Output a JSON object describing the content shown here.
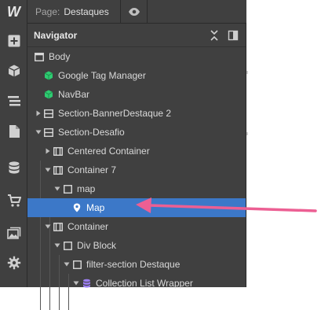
{
  "app": {
    "logo": "W"
  },
  "topbar": {
    "page_label": "Page:",
    "page_name": "Destaques"
  },
  "rail_icons": [
    "add-icon",
    "box-icon",
    "navigator-icon",
    "pages-icon",
    "cms-icon",
    "ecommerce-icon",
    "assets-icon",
    "settings-icon"
  ],
  "navigator": {
    "title": "Navigator",
    "items": [
      {
        "label": "Body",
        "icon": "body-icon"
      },
      {
        "label": "Google Tag Manager",
        "icon": "symbol-icon"
      },
      {
        "label": "NavBar",
        "icon": "symbol-icon"
      },
      {
        "label": "Section-BannerDestaque 2",
        "icon": "section-icon"
      },
      {
        "label": "Section-Desafio",
        "icon": "section-icon"
      },
      {
        "label": "Centered Container",
        "icon": "container-icon"
      },
      {
        "label": "Container 7",
        "icon": "container-icon"
      },
      {
        "label": "map",
        "icon": "div-icon"
      },
      {
        "label": "Map",
        "icon": "map-pin-icon",
        "selected": true
      },
      {
        "label": "Container",
        "icon": "container-icon"
      },
      {
        "label": "Div Block",
        "icon": "div-icon"
      },
      {
        "label": "filter-section Destaque",
        "icon": "div-icon"
      },
      {
        "label": "Collection List Wrapper",
        "icon": "collection-icon"
      }
    ]
  },
  "colors": {
    "panel_bg": "#404040",
    "selected_bg": "#3c78c8",
    "symbol_green": "#2ecc71",
    "collection_purple": "#9b7ef0",
    "annotation_arrow": "#ec5f93"
  }
}
